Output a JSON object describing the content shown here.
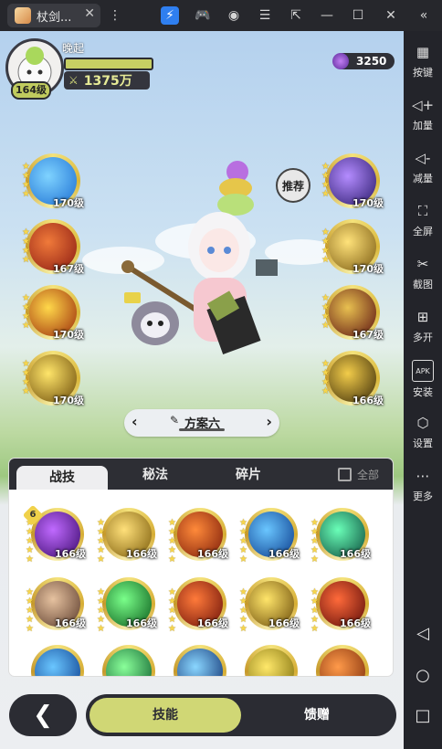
{
  "window": {
    "tab_title": "杖剑...",
    "close_glyph": "✕",
    "more_glyph": "⋮",
    "icons": [
      "bolt-icon",
      "gamepad-icon",
      "user-icon",
      "menu-icon",
      "popout-icon",
      "minimize-icon",
      "maximize-icon",
      "close-icon",
      "collapse-icon"
    ]
  },
  "sidebar": {
    "items": [
      {
        "label": "按键",
        "icon": "keyboard-icon",
        "glyph": "▦"
      },
      {
        "label": "加量",
        "icon": "volume-up-icon",
        "glyph": "◁+"
      },
      {
        "label": "减量",
        "icon": "volume-down-icon",
        "glyph": "◁-"
      },
      {
        "label": "全屏",
        "icon": "fullscreen-icon",
        "glyph": "⛶"
      },
      {
        "label": "截图",
        "icon": "scissors-icon",
        "glyph": "✂"
      },
      {
        "label": "多开",
        "icon": "multi-instance-icon",
        "glyph": "⊞"
      },
      {
        "label": "安装",
        "icon": "apk-icon",
        "glyph": "APK"
      },
      {
        "label": "设置",
        "icon": "settings-icon",
        "glyph": "⬡"
      },
      {
        "label": "更多",
        "icon": "more-icon",
        "glyph": "⋯"
      }
    ],
    "nav": [
      {
        "icon": "nav-back-icon",
        "glyph": "◁"
      },
      {
        "icon": "nav-home-icon",
        "glyph": "○"
      },
      {
        "icon": "nav-recent-icon",
        "glyph": "□"
      }
    ]
  },
  "player": {
    "name": "晚起",
    "level": "164级",
    "power": "1375万",
    "power_icon": "sword-cross-icon",
    "gems": "3250"
  },
  "left_skills": [
    {
      "level": "170级",
      "stars": 4,
      "colors": [
        "#1c6fd3",
        "#7fd3ff"
      ]
    },
    {
      "level": "167级",
      "stars": 4,
      "colors": [
        "#8b1a12",
        "#f07a3a"
      ]
    },
    {
      "level": "170级",
      "stars": 4,
      "colors": [
        "#9b2a0a",
        "#ffd84a"
      ]
    },
    {
      "level": "170级",
      "stars": 4,
      "colors": [
        "#6b4a08",
        "#ffe56a"
      ]
    }
  ],
  "right_skills": [
    {
      "level": "170级",
      "stars": 4,
      "colors": [
        "#2a1a6b",
        "#b48cff"
      ]
    },
    {
      "level": "170级",
      "stars": 4,
      "colors": [
        "#7a5a10",
        "#ffe27a"
      ]
    },
    {
      "level": "167级",
      "stars": 4,
      "colors": [
        "#5a1010",
        "#e8c050"
      ]
    },
    {
      "level": "166级",
      "stars": 4,
      "colors": [
        "#3a2a08",
        "#f2cc4a"
      ]
    }
  ],
  "recommend_label": "推荐",
  "plan": {
    "label": "方案六",
    "edit_icon": "pencil-icon",
    "prev": "‹",
    "next": "›"
  },
  "panel": {
    "tabs": [
      "战技",
      "秘法",
      "碎片"
    ],
    "active_tab": 0,
    "all_label": "全部",
    "grid": [
      {
        "level": "166级",
        "stars": 5,
        "badge": "6",
        "colors": [
          "#3a0a6b",
          "#c06aff"
        ]
      },
      {
        "level": "166级",
        "stars": 5,
        "colors": [
          "#7a5a08",
          "#ffe07a"
        ]
      },
      {
        "level": "166级",
        "stars": 5,
        "colors": [
          "#7a1a08",
          "#ff8a3a"
        ]
      },
      {
        "level": "166级",
        "stars": 5,
        "colors": [
          "#0a3a8b",
          "#6ac6ff"
        ]
      },
      {
        "level": "166级",
        "stars": 5,
        "colors": [
          "#0a4a3a",
          "#6affb8"
        ]
      },
      {
        "level": "166级",
        "stars": 5,
        "colors": [
          "#5a3a2a",
          "#e6c2a0"
        ]
      },
      {
        "level": "166级",
        "stars": 5,
        "colors": [
          "#0a5a1a",
          "#7aff8a"
        ]
      },
      {
        "level": "166级",
        "stars": 5,
        "colors": [
          "#6a1008",
          "#ff7a3a"
        ]
      },
      {
        "level": "166级",
        "stars": 5,
        "colors": [
          "#6a4a08",
          "#ffe56a"
        ]
      },
      {
        "level": "166级",
        "stars": 5,
        "colors": [
          "#5a0a08",
          "#ff6a3a"
        ]
      },
      {
        "level": "",
        "stars": 0,
        "colors": [
          "#0a3a8b",
          "#6ac6ff"
        ]
      },
      {
        "level": "",
        "stars": 0,
        "colors": [
          "#0a5a2a",
          "#8aff9a"
        ]
      },
      {
        "level": "",
        "stars": 0,
        "colors": [
          "#0a2a6b",
          "#8ad6ff"
        ]
      },
      {
        "level": "",
        "stars": 0,
        "colors": [
          "#7a6a08",
          "#ffe86a"
        ]
      },
      {
        "level": "",
        "stars": 0,
        "colors": [
          "#7a2a08",
          "#ff9a4a"
        ]
      }
    ]
  },
  "bottom": {
    "back_glyph": "❮",
    "tabs": [
      "技能",
      "馈赠"
    ],
    "active_tab": 0
  }
}
